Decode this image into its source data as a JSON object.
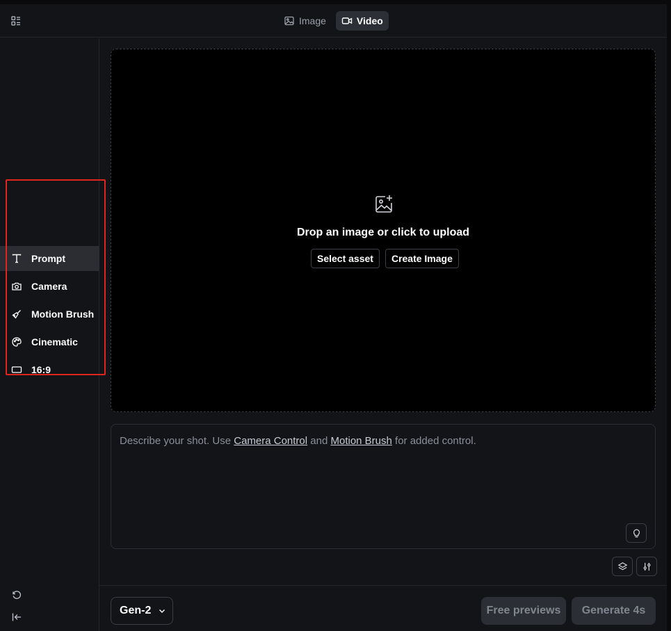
{
  "header": {
    "tabs": [
      {
        "label": "Image",
        "icon": "image-icon",
        "active": false
      },
      {
        "label": "Video",
        "icon": "video-icon",
        "active": true
      }
    ]
  },
  "sidebar": {
    "items": [
      {
        "label": "Prompt",
        "icon": "text-icon",
        "active": true
      },
      {
        "label": "Camera",
        "icon": "camera-icon",
        "active": false
      },
      {
        "label": "Motion Brush",
        "icon": "brush-icon",
        "active": false
      },
      {
        "label": "Cinematic",
        "icon": "palette-icon",
        "active": false
      },
      {
        "label": "16:9",
        "icon": "aspect-ratio-icon",
        "active": false
      }
    ]
  },
  "dropzone": {
    "title": "Drop an image or click to upload",
    "select_asset": "Select asset",
    "create_image": "Create Image"
  },
  "prompt": {
    "part1": "Describe your shot. Use ",
    "link1": "Camera Control",
    "part2": " and ",
    "link2": "Motion Brush",
    "part3": " for added control."
  },
  "footer": {
    "model": "Gen-2",
    "free_previews": "Free previews",
    "generate": "Generate 4s"
  },
  "colors": {
    "background": "#131418",
    "canvas": "#000000",
    "active_tab": "#2d2f36",
    "highlight_box": "#e0261c",
    "disabled_button": "#2c2e35"
  }
}
